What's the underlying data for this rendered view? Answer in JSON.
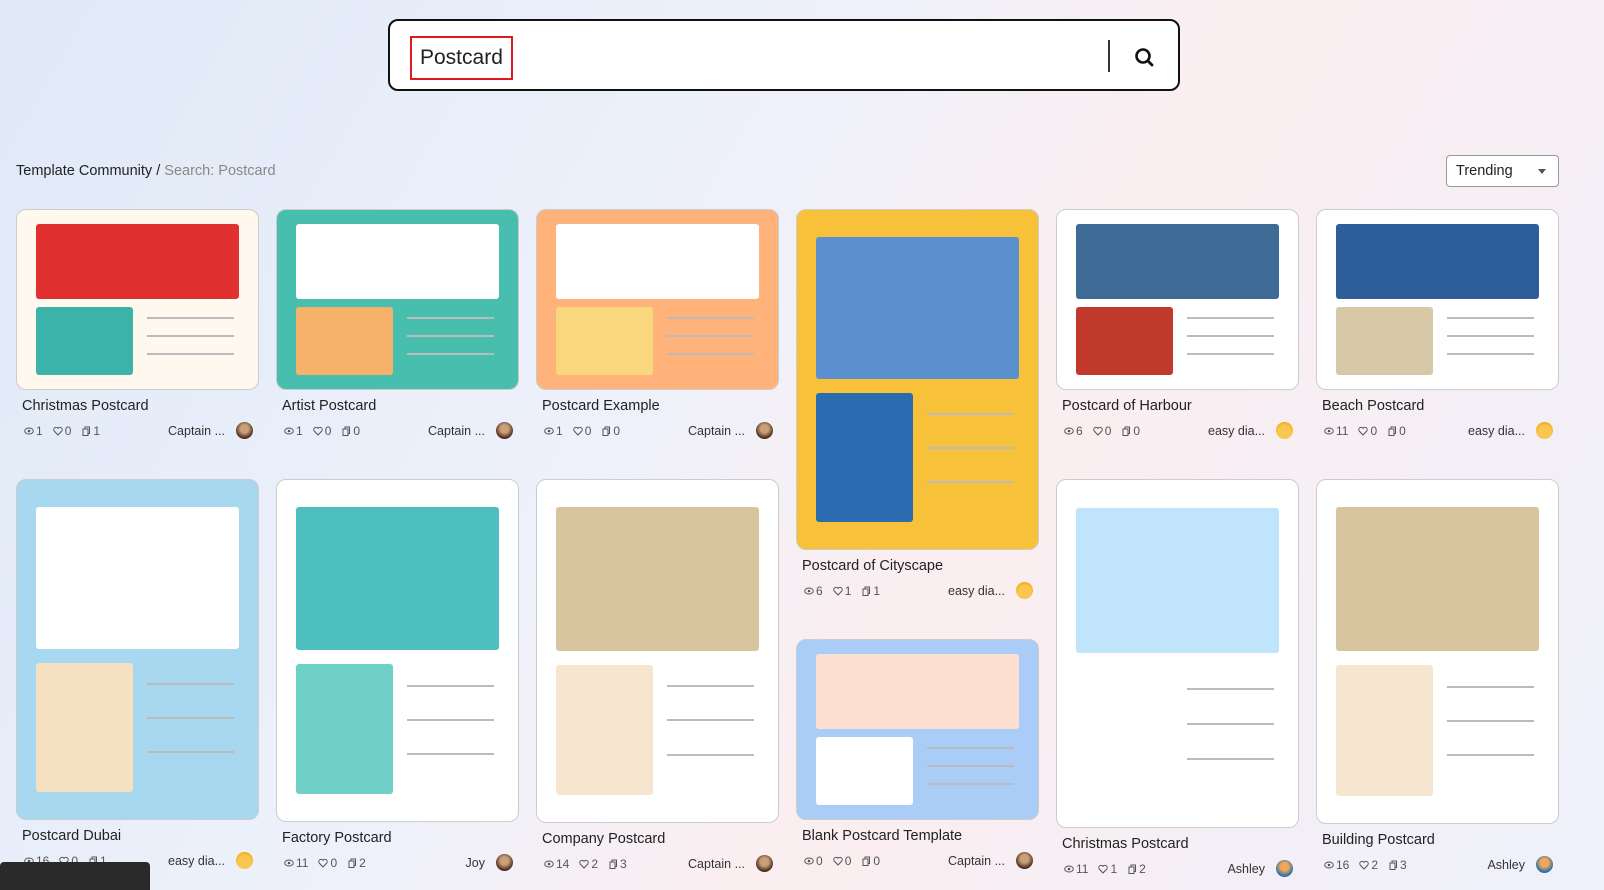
{
  "search": {
    "query": "Postcard",
    "icon": "search-icon"
  },
  "breadcrumb": {
    "root": "Template Community",
    "separator": " / ",
    "current": "Search: Postcard"
  },
  "sort": {
    "selected": "Trending"
  },
  "cards": [
    {
      "title": "Christmas Postcard",
      "views": "1",
      "likes": "0",
      "copies": "1",
      "author": "Captain ..."
    },
    {
      "title": "Artist Postcard",
      "views": "1",
      "likes": "0",
      "copies": "0",
      "author": "Captain ..."
    },
    {
      "title": "Postcard Example",
      "views": "1",
      "likes": "0",
      "copies": "0",
      "author": "Captain ..."
    },
    {
      "title": "Postcard of Cityscape",
      "views": "6",
      "likes": "1",
      "copies": "1",
      "author": "easy dia..."
    },
    {
      "title": "Postcard of Harbour",
      "views": "6",
      "likes": "0",
      "copies": "0",
      "author": "easy dia..."
    },
    {
      "title": "Beach Postcard",
      "views": "11",
      "likes": "0",
      "copies": "0",
      "author": "easy dia..."
    },
    {
      "title": "Postcard Dubai",
      "views": "16",
      "likes": "0",
      "copies": "1",
      "author": "easy dia..."
    },
    {
      "title": "Factory Postcard",
      "views": "11",
      "likes": "0",
      "copies": "2",
      "author": "Joy"
    },
    {
      "title": "Company Postcard",
      "views": "14",
      "likes": "2",
      "copies": "3",
      "author": "Captain ..."
    },
    {
      "title": "Blank Postcard Template",
      "views": "0",
      "likes": "0",
      "copies": "0",
      "author": "Captain ..."
    },
    {
      "title": "Christmas Postcard",
      "views": "11",
      "likes": "1",
      "copies": "2",
      "author": "Ashley"
    },
    {
      "title": "Building Postcard",
      "views": "16",
      "likes": "2",
      "copies": "3",
      "author": "Ashley"
    }
  ]
}
